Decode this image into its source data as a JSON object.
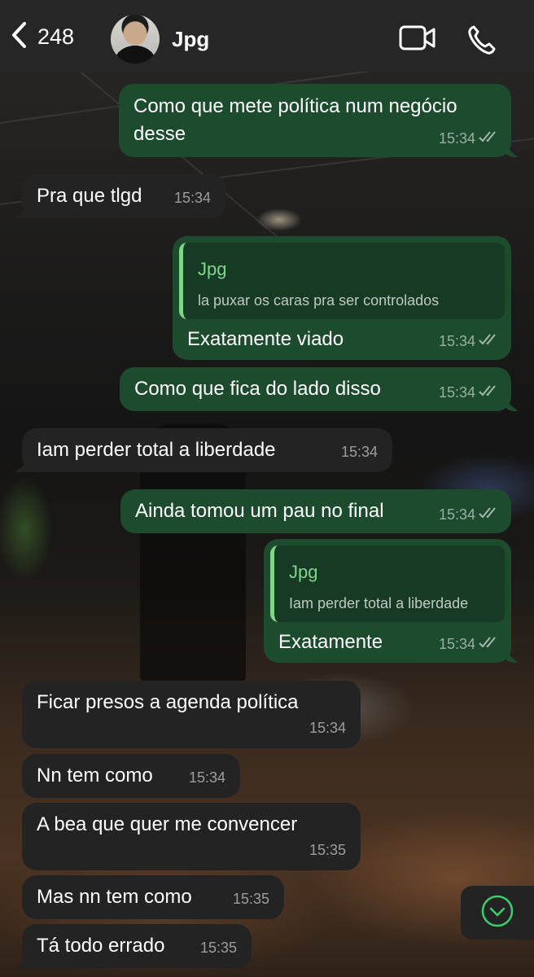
{
  "header": {
    "back_count": "248",
    "contact_name": "Jpg"
  },
  "messages": [
    {
      "dir": "out",
      "lines": [
        "Como que mete política num negócio",
        "desse"
      ],
      "time": "15:34",
      "read": true
    },
    {
      "dir": "in",
      "text": "Pra que tlgd",
      "time": "15:34"
    },
    {
      "dir": "out",
      "quote_author": "Jpg",
      "quote_text": "la puxar os caras pra ser controlados",
      "text": "Exatamente viado",
      "time": "15:34",
      "read": true
    },
    {
      "dir": "out",
      "text": "Como que fica do lado disso",
      "time": "15:34",
      "read": true
    },
    {
      "dir": "in",
      "text": "Iam perder total a liberdade",
      "time": "15:34"
    },
    {
      "dir": "out",
      "text": "Ainda tomou um pau no final",
      "time": "15:34",
      "read": true
    },
    {
      "dir": "out",
      "quote_author": "Jpg",
      "quote_text": "Iam perder total a liberdade",
      "text": "Exatamente",
      "time": "15:34",
      "read": true
    },
    {
      "dir": "in",
      "text": "Ficar presos a agenda política",
      "time": "15:34"
    },
    {
      "dir": "in",
      "text": "Nn tem como",
      "time": "15:34"
    },
    {
      "dir": "in",
      "text": "A bea que quer me convencer",
      "time": "15:35"
    },
    {
      "dir": "in",
      "text": "Mas nn tem como",
      "time": "15:35"
    },
    {
      "dir": "in",
      "text": "Tá todo errado",
      "time": "15:35"
    }
  ],
  "colors": {
    "outgoing_bubble": "#1c4b2d",
    "incoming_bubble": "#232323",
    "quote_accent": "#7fd68a",
    "header_bg": "#262626"
  },
  "icons": [
    "back-chevron-icon",
    "video-call-icon",
    "phone-call-icon",
    "double-check-icon",
    "scroll-down-icon"
  ]
}
